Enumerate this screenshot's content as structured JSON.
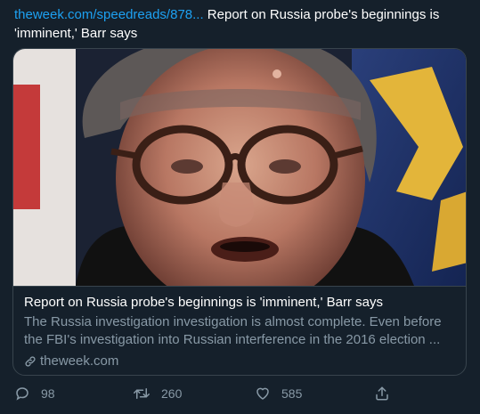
{
  "tweet": {
    "link_text": "theweek.com/speedreads/878...",
    "text": " Report on Russia probe's beginnings is 'imminent,' Barr says"
  },
  "card": {
    "title": "Report on Russia probe's beginnings is 'imminent,' Barr says",
    "description": "The Russia investigation investigation is almost complete. Even before the FBI's investigation into Russian interference in the 2016 election ...",
    "domain": "theweek.com",
    "image_icon": "news-photo"
  },
  "actions": {
    "reply_count": "98",
    "retweet_count": "260",
    "like_count": "585"
  },
  "colors": {
    "background": "#15202b",
    "link": "#1da1f2",
    "muted": "#8899a6",
    "border": "#38444d"
  }
}
